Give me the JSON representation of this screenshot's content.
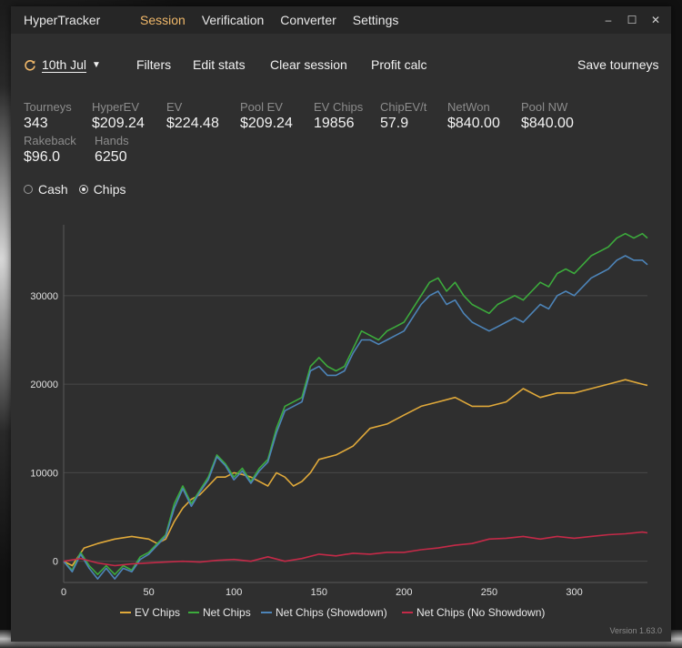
{
  "app": {
    "title": "HyperTracker",
    "version": "Version 1.63.0"
  },
  "nav": [
    {
      "label": "Session",
      "active": true
    },
    {
      "label": "Verification",
      "active": false
    },
    {
      "label": "Converter",
      "active": false
    },
    {
      "label": "Settings",
      "active": false
    }
  ],
  "window_controls": {
    "minimize": "–",
    "maximize": "☐",
    "close": "✕"
  },
  "toolbar": {
    "date": "10th Jul",
    "filters": "Filters",
    "edit_stats": "Edit stats",
    "clear_session": "Clear session",
    "profit_calc": "Profit calc",
    "save_tourneys": "Save tourneys"
  },
  "stats": [
    {
      "label": "Tourneys",
      "value": "343"
    },
    {
      "label": "HyperEV",
      "value": "$209.24"
    },
    {
      "label": "EV",
      "value": "$224.48"
    },
    {
      "label": "Pool EV",
      "value": "$209.24"
    },
    {
      "label": "EV Chips",
      "value": "19856"
    },
    {
      "label": "ChipEV/t",
      "value": "57.9"
    },
    {
      "label": "NetWon",
      "value": "$840.00"
    },
    {
      "label": "Pool NW",
      "value": "$840.00"
    },
    {
      "label": "Rakeback",
      "value": "$96.0"
    },
    {
      "label": "Hands",
      "value": "6250"
    }
  ],
  "mode": {
    "options": [
      "Cash",
      "Chips"
    ],
    "selected": "Chips"
  },
  "colors": {
    "ev": "#e0a93a",
    "net": "#3cab3c",
    "showdown": "#4d84b8",
    "no_showdown": "#c42a48",
    "accent": "#f0b86a"
  },
  "chart_data": {
    "type": "line",
    "xlim": [
      0,
      343
    ],
    "ylim": [
      -2400,
      38000
    ],
    "x_ticks": [
      0,
      50,
      100,
      150,
      200,
      250,
      300
    ],
    "y_ticks": [
      0,
      10000,
      20000,
      30000
    ],
    "grid": "horizontal",
    "legend_position": "bottom",
    "series": [
      {
        "name": "EV Chips",
        "color": "#e0a93a",
        "points": [
          [
            0,
            0
          ],
          [
            5,
            -500
          ],
          [
            12,
            1500
          ],
          [
            20,
            2000
          ],
          [
            30,
            2500
          ],
          [
            40,
            2800
          ],
          [
            50,
            2500
          ],
          [
            55,
            2000
          ],
          [
            60,
            2500
          ],
          [
            65,
            4500
          ],
          [
            70,
            6000
          ],
          [
            75,
            7000
          ],
          [
            80,
            7500
          ],
          [
            85,
            8500
          ],
          [
            90,
            9500
          ],
          [
            95,
            9500
          ],
          [
            100,
            10000
          ],
          [
            105,
            9800
          ],
          [
            110,
            9500
          ],
          [
            115,
            9000
          ],
          [
            120,
            8500
          ],
          [
            125,
            10000
          ],
          [
            130,
            9500
          ],
          [
            135,
            8500
          ],
          [
            140,
            9000
          ],
          [
            145,
            10000
          ],
          [
            150,
            11500
          ],
          [
            160,
            12000
          ],
          [
            170,
            13000
          ],
          [
            180,
            15000
          ],
          [
            190,
            15500
          ],
          [
            200,
            16500
          ],
          [
            210,
            17500
          ],
          [
            220,
            18000
          ],
          [
            230,
            18500
          ],
          [
            240,
            17500
          ],
          [
            250,
            17500
          ],
          [
            260,
            18000
          ],
          [
            270,
            19500
          ],
          [
            280,
            18500
          ],
          [
            290,
            19000
          ],
          [
            300,
            19000
          ],
          [
            310,
            19500
          ],
          [
            320,
            20000
          ],
          [
            330,
            20500
          ],
          [
            340,
            20000
          ],
          [
            343,
            19856
          ]
        ]
      },
      {
        "name": "Net Chips",
        "color": "#3cab3c",
        "points": [
          [
            0,
            0
          ],
          [
            5,
            -1000
          ],
          [
            10,
            1000
          ],
          [
            15,
            -500
          ],
          [
            20,
            -1500
          ],
          [
            25,
            -500
          ],
          [
            30,
            -1500
          ],
          [
            35,
            -500
          ],
          [
            40,
            -1000
          ],
          [
            45,
            500
          ],
          [
            50,
            1000
          ],
          [
            55,
            2000
          ],
          [
            60,
            3000
          ],
          [
            65,
            6500
          ],
          [
            70,
            8500
          ],
          [
            75,
            6500
          ],
          [
            80,
            8000
          ],
          [
            85,
            9500
          ],
          [
            90,
            12000
          ],
          [
            95,
            11000
          ],
          [
            100,
            9500
          ],
          [
            105,
            10500
          ],
          [
            110,
            9000
          ],
          [
            115,
            10500
          ],
          [
            120,
            11500
          ],
          [
            125,
            15000
          ],
          [
            130,
            17500
          ],
          [
            135,
            18000
          ],
          [
            140,
            18500
          ],
          [
            145,
            22000
          ],
          [
            150,
            23000
          ],
          [
            155,
            22000
          ],
          [
            160,
            21500
          ],
          [
            165,
            22000
          ],
          [
            170,
            24000
          ],
          [
            175,
            26000
          ],
          [
            180,
            25500
          ],
          [
            185,
            25000
          ],
          [
            190,
            26000
          ],
          [
            195,
            26500
          ],
          [
            200,
            27000
          ],
          [
            205,
            28500
          ],
          [
            210,
            30000
          ],
          [
            215,
            31500
          ],
          [
            220,
            32000
          ],
          [
            225,
            30500
          ],
          [
            230,
            31500
          ],
          [
            235,
            30000
          ],
          [
            240,
            29000
          ],
          [
            245,
            28500
          ],
          [
            250,
            28000
          ],
          [
            255,
            29000
          ],
          [
            260,
            29500
          ],
          [
            265,
            30000
          ],
          [
            270,
            29500
          ],
          [
            275,
            30500
          ],
          [
            280,
            31500
          ],
          [
            285,
            31000
          ],
          [
            290,
            32500
          ],
          [
            295,
            33000
          ],
          [
            300,
            32500
          ],
          [
            305,
            33500
          ],
          [
            310,
            34500
          ],
          [
            315,
            35000
          ],
          [
            320,
            35500
          ],
          [
            325,
            36500
          ],
          [
            330,
            37000
          ],
          [
            335,
            36500
          ],
          [
            340,
            37000
          ],
          [
            343,
            36500
          ]
        ]
      },
      {
        "name": "Net Chips (Showdown)",
        "color": "#4d84b8",
        "points": [
          [
            0,
            0
          ],
          [
            5,
            -1200
          ],
          [
            10,
            800
          ],
          [
            15,
            -800
          ],
          [
            20,
            -2000
          ],
          [
            25,
            -800
          ],
          [
            30,
            -2000
          ],
          [
            35,
            -800
          ],
          [
            40,
            -1200
          ],
          [
            45,
            200
          ],
          [
            50,
            800
          ],
          [
            55,
            1800
          ],
          [
            60,
            2800
          ],
          [
            65,
            6000
          ],
          [
            70,
            8200
          ],
          [
            75,
            6200
          ],
          [
            80,
            7800
          ],
          [
            85,
            9200
          ],
          [
            90,
            11800
          ],
          [
            95,
            10800
          ],
          [
            100,
            9200
          ],
          [
            105,
            10200
          ],
          [
            110,
            8800
          ],
          [
            115,
            10200
          ],
          [
            120,
            11200
          ],
          [
            125,
            14500
          ],
          [
            130,
            17000
          ],
          [
            135,
            17500
          ],
          [
            140,
            18000
          ],
          [
            145,
            21500
          ],
          [
            150,
            22000
          ],
          [
            155,
            21000
          ],
          [
            160,
            21000
          ],
          [
            165,
            21500
          ],
          [
            170,
            23500
          ],
          [
            175,
            25000
          ],
          [
            180,
            25000
          ],
          [
            185,
            24500
          ],
          [
            190,
            25000
          ],
          [
            195,
            25500
          ],
          [
            200,
            26000
          ],
          [
            205,
            27500
          ],
          [
            210,
            29000
          ],
          [
            215,
            30000
          ],
          [
            220,
            30500
          ],
          [
            225,
            29000
          ],
          [
            230,
            29500
          ],
          [
            235,
            28000
          ],
          [
            240,
            27000
          ],
          [
            245,
            26500
          ],
          [
            250,
            26000
          ],
          [
            255,
            26500
          ],
          [
            260,
            27000
          ],
          [
            265,
            27500
          ],
          [
            270,
            27000
          ],
          [
            275,
            28000
          ],
          [
            280,
            29000
          ],
          [
            285,
            28500
          ],
          [
            290,
            30000
          ],
          [
            295,
            30500
          ],
          [
            300,
            30000
          ],
          [
            305,
            31000
          ],
          [
            310,
            32000
          ],
          [
            315,
            32500
          ],
          [
            320,
            33000
          ],
          [
            325,
            34000
          ],
          [
            330,
            34500
          ],
          [
            335,
            34000
          ],
          [
            340,
            34000
          ],
          [
            343,
            33500
          ]
        ]
      },
      {
        "name": "Net Chips (No Showdown)",
        "color": "#c42a48",
        "points": [
          [
            0,
            0
          ],
          [
            10,
            300
          ],
          [
            20,
            -200
          ],
          [
            30,
            -500
          ],
          [
            40,
            -300
          ],
          [
            50,
            -200
          ],
          [
            60,
            -100
          ],
          [
            70,
            0
          ],
          [
            80,
            -100
          ],
          [
            90,
            100
          ],
          [
            100,
            200
          ],
          [
            110,
            0
          ],
          [
            120,
            500
          ],
          [
            130,
            0
          ],
          [
            140,
            300
          ],
          [
            150,
            800
          ],
          [
            160,
            600
          ],
          [
            170,
            900
          ],
          [
            180,
            800
          ],
          [
            190,
            1000
          ],
          [
            200,
            1000
          ],
          [
            210,
            1300
          ],
          [
            220,
            1500
          ],
          [
            230,
            1800
          ],
          [
            240,
            2000
          ],
          [
            250,
            2500
          ],
          [
            260,
            2600
          ],
          [
            270,
            2800
          ],
          [
            280,
            2500
          ],
          [
            290,
            2800
          ],
          [
            300,
            2600
          ],
          [
            310,
            2800
          ],
          [
            320,
            3000
          ],
          [
            330,
            3100
          ],
          [
            340,
            3300
          ],
          [
            343,
            3200
          ]
        ]
      }
    ]
  }
}
